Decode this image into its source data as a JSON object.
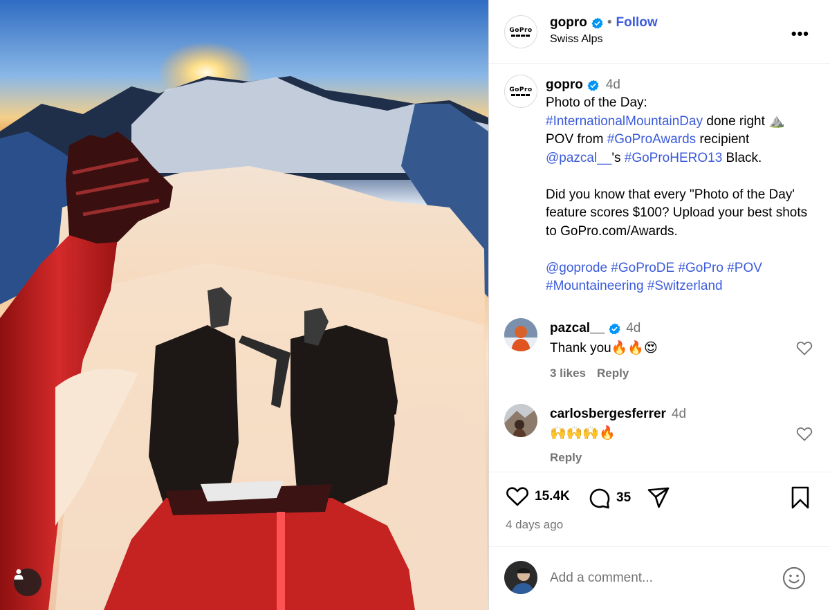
{
  "post": {
    "image_alt": "",
    "user_tag_icon": "person-icon"
  },
  "header": {
    "username": "gopro",
    "separator": "•",
    "follow_label": "Follow",
    "location": "Swiss Alps",
    "more_label": "•••",
    "logo_text": "GoPro"
  },
  "caption": {
    "username": "gopro",
    "time": "4d",
    "line1": "Photo of the Day:",
    "hashtag1": "#InternationalMountainDay",
    "line2_rest": " done right ⛰️",
    "line3_prefix": "POV from ",
    "hashtag2": "#GoProAwards",
    "line3_rest": " recipient",
    "mention": "@pazcal__",
    "line4_mid": "'s ",
    "hashtag3": "#GoProHERO13",
    "line4_rest": " Black.",
    "para2": "Did you know that every \"Photo of the Day' feature scores $100? Upload your best shots to GoPro.com/Awards.",
    "tags_line1": "@goprode #GoProDE #GoPro #POV",
    "tags_line2": "#Mountaineering #Switzerland"
  },
  "comments": [
    {
      "username": "pazcal__",
      "verified": true,
      "time": "4d",
      "text": "Thank you🔥🔥😍",
      "likes": "3 likes",
      "reply_label": "Reply"
    },
    {
      "username": "carlosbergesferrer",
      "verified": false,
      "time": "4d",
      "text": "🙌🙌🙌🔥",
      "reply_label": "Reply"
    }
  ],
  "actions": {
    "like_count": "15.4K",
    "comment_count": "35",
    "posted_ago": "4 days ago"
  },
  "add_comment": {
    "placeholder": "Add a comment..."
  },
  "colors": {
    "link": "#3b5bdb",
    "verified": "#0095f6",
    "muted": "#737373"
  }
}
